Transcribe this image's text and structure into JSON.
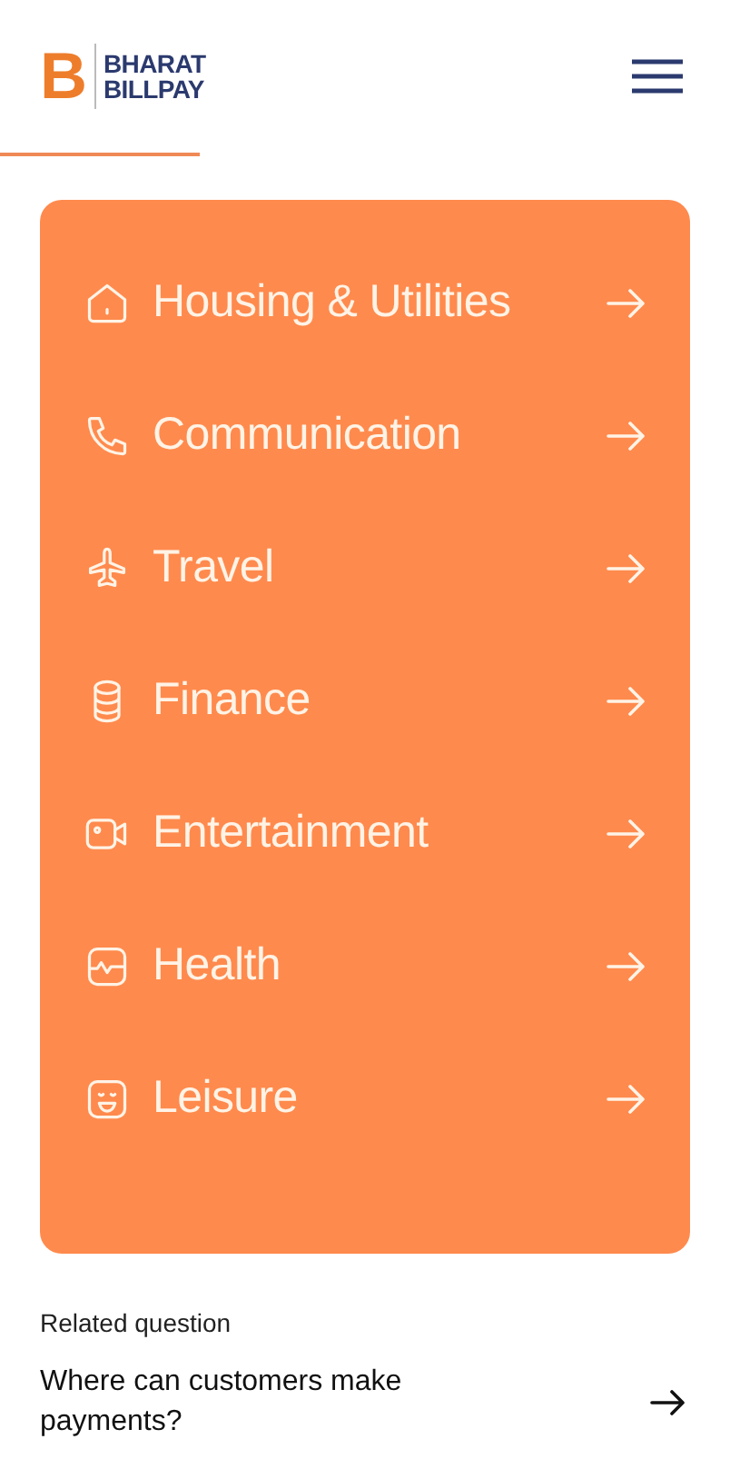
{
  "header": {
    "logo": {
      "mark": "B",
      "line1": "BHARAT",
      "line2": "BILLPAY"
    }
  },
  "categories": [
    {
      "kind": "house",
      "label": "Housing & Utilities"
    },
    {
      "kind": "phone",
      "label": "Communication"
    },
    {
      "kind": "plane",
      "label": "Travel"
    },
    {
      "kind": "coins",
      "label": "Finance"
    },
    {
      "kind": "video",
      "label": "Entertainment"
    },
    {
      "kind": "pulse",
      "label": "Health"
    },
    {
      "kind": "smile",
      "label": "Leisure"
    }
  ],
  "related": {
    "heading": "Related question",
    "question": "Where can customers make payments?"
  }
}
